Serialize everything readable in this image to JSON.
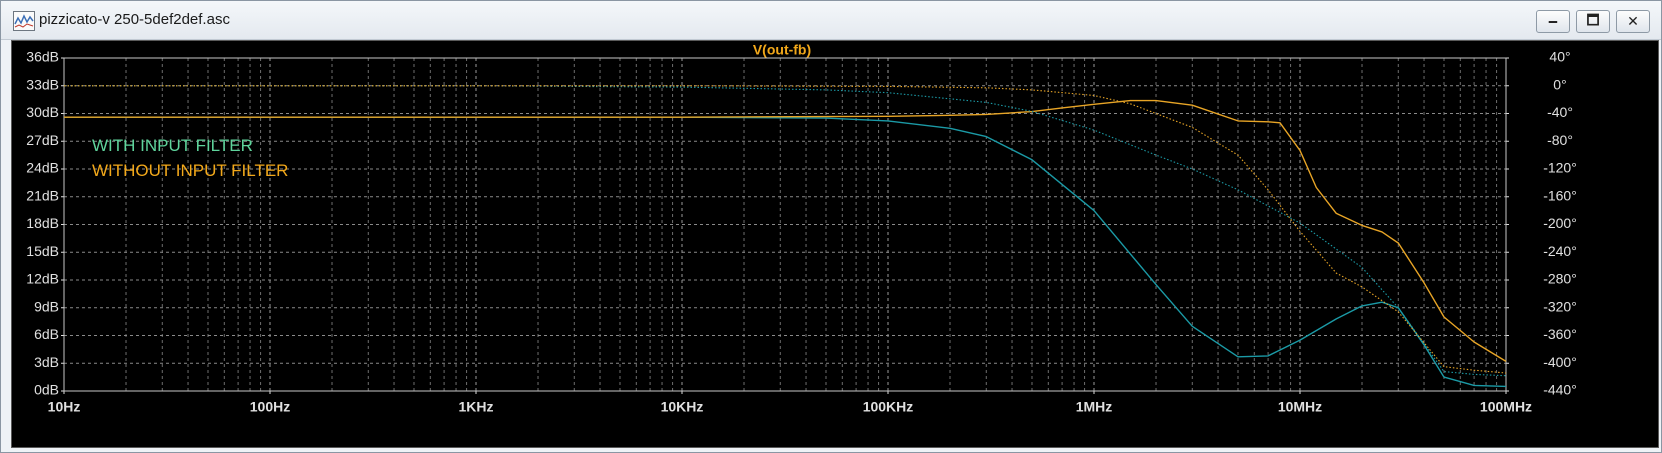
{
  "window": {
    "title": "pizzicato-v 250-5def2def.asc",
    "icon": "waveform-plot-icon",
    "minimize_glyph": "🗕",
    "maximize_glyph": "🗖",
    "close_glyph": "✕"
  },
  "chart_data": {
    "type": "line",
    "title": "V(out-fb)",
    "x_scale": "log",
    "xlim": [
      10,
      100000000
    ],
    "x_ticks": [
      {
        "value": 10,
        "label": "10Hz"
      },
      {
        "value": 100,
        "label": "100Hz"
      },
      {
        "value": 1000,
        "label": "1KHz"
      },
      {
        "value": 10000,
        "label": "10KHz"
      },
      {
        "value": 100000,
        "label": "100KHz"
      },
      {
        "value": 1000000,
        "label": "1MHz"
      },
      {
        "value": 10000000,
        "label": "10MHz"
      },
      {
        "value": 100000000,
        "label": "100MHz"
      }
    ],
    "y_left": {
      "unit": "dB",
      "ylim": [
        0,
        36
      ],
      "ticks": [
        {
          "value": 36,
          "label": "36dB"
        },
        {
          "value": 33,
          "label": "33dB"
        },
        {
          "value": 30,
          "label": "30dB"
        },
        {
          "value": 27,
          "label": "27dB"
        },
        {
          "value": 24,
          "label": "24dB"
        },
        {
          "value": 21,
          "label": "21dB"
        },
        {
          "value": 18,
          "label": "18dB"
        },
        {
          "value": 15,
          "label": "15dB"
        },
        {
          "value": 12,
          "label": "12dB"
        },
        {
          "value": 9,
          "label": "9dB"
        },
        {
          "value": 6,
          "label": "6dB"
        },
        {
          "value": 3,
          "label": "3dB"
        },
        {
          "value": 0,
          "label": "0dB"
        }
      ]
    },
    "y_right": {
      "unit": "°",
      "ylim": [
        -440,
        40
      ],
      "ticks": [
        {
          "value": 40,
          "label": "40°"
        },
        {
          "value": 0,
          "label": "0°"
        },
        {
          "value": -40,
          "label": "-40°"
        },
        {
          "value": -80,
          "label": "-80°"
        },
        {
          "value": -120,
          "label": "-120°"
        },
        {
          "value": -160,
          "label": "-160°"
        },
        {
          "value": -200,
          "label": "-200°"
        },
        {
          "value": -240,
          "label": "-240°"
        },
        {
          "value": -280,
          "label": "-280°"
        },
        {
          "value": -320,
          "label": "-320°"
        },
        {
          "value": -360,
          "label": "-360°"
        },
        {
          "value": -400,
          "label": "-400°"
        },
        {
          "value": -440,
          "label": "-440°"
        }
      ]
    },
    "grid": true,
    "legend": {
      "placement": "top-left",
      "entries": [
        {
          "label": "WITH INPUT FILTER",
          "color": "#5fd49c"
        },
        {
          "label": "WITHOUT INPUT FILTER",
          "color": "#f2a81a"
        }
      ]
    },
    "series": [
      {
        "color": "#1b9aa6",
        "axis": "left",
        "style": "solid",
        "x": [
          10,
          1000,
          10000,
          50000,
          100000,
          200000,
          300000,
          500000,
          1000000,
          2000000,
          3000000,
          5000000,
          7000000,
          10000000,
          15000000,
          20000000,
          25000000,
          30000000,
          40000000,
          50000000,
          70000000,
          100000000
        ],
        "y": [
          29.6,
          29.6,
          29.6,
          29.5,
          29.2,
          28.4,
          27.5,
          25.0,
          19.5,
          11.5,
          7.0,
          3.7,
          3.8,
          5.5,
          7.8,
          9.2,
          9.6,
          9.0,
          5.0,
          1.5,
          0.6,
          0.5
        ]
      },
      {
        "color": "#e8a526",
        "axis": "left",
        "style": "solid",
        "x": [
          10,
          10000,
          100000,
          200000,
          300000,
          500000,
          700000,
          1000000,
          1500000,
          2000000,
          3000000,
          5000000,
          7000000,
          8000000,
          10000000,
          12000000,
          15000000,
          20000000,
          25000000,
          30000000,
          40000000,
          50000000,
          70000000,
          100000000
        ],
        "y": [
          29.6,
          29.6,
          29.7,
          29.8,
          29.9,
          30.2,
          30.6,
          31.0,
          31.4,
          31.4,
          30.9,
          29.2,
          29.1,
          29.0,
          26.0,
          22.0,
          19.2,
          17.9,
          17.2,
          16.0,
          11.7,
          8.0,
          5.3,
          3.2
        ]
      },
      {
        "color": "#1b9aa6",
        "axis": "right",
        "style": "dotted",
        "x": [
          10,
          1000,
          10000,
          50000,
          100000,
          300000,
          500000,
          1000000,
          2000000,
          3000000,
          5000000,
          10000000,
          20000000,
          30000000,
          50000000,
          70000000,
          100000000
        ],
        "y": [
          0,
          0,
          -2,
          -6,
          -10,
          -24,
          -37,
          -64,
          -100,
          -120,
          -150,
          -198,
          -262,
          -320,
          -412,
          -416,
          -418
        ]
      },
      {
        "color": "#e8a526",
        "axis": "right",
        "style": "dotted",
        "x": [
          10,
          1000,
          10000,
          100000,
          300000,
          500000,
          1000000,
          1500000,
          2000000,
          3000000,
          5000000,
          7000000,
          10000000,
          15000000,
          20000000,
          30000000,
          50000000,
          70000000,
          100000000
        ],
        "y": [
          0,
          0,
          0,
          -1,
          -3,
          -6,
          -14,
          -26,
          -40,
          -60,
          -100,
          -150,
          -210,
          -270,
          -290,
          -326,
          -405,
          -410,
          -414
        ]
      }
    ]
  }
}
